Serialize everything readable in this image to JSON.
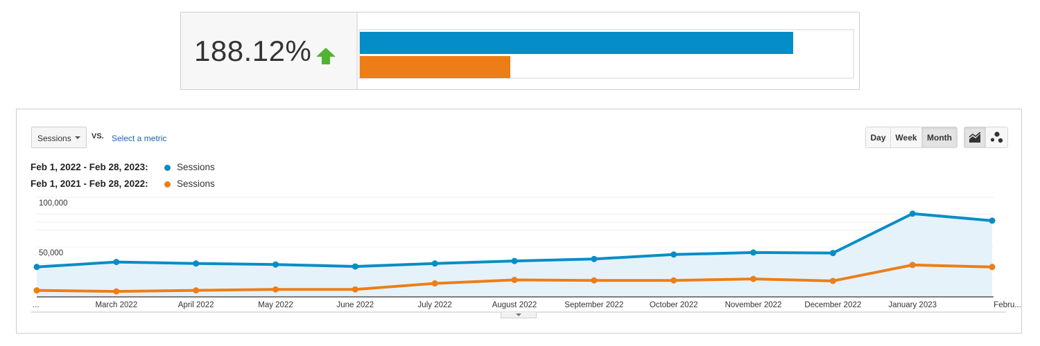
{
  "comparison": {
    "percent_change": "188.12%",
    "direction_icon": "up-arrow-icon",
    "current_bar_fraction": 0.879,
    "previous_bar_fraction": 0.305,
    "colors": {
      "current": "#058dc7",
      "previous": "#ed7e17",
      "up": "#50b432"
    }
  },
  "controls": {
    "metric_select": "Sessions",
    "vs_label": "VS.",
    "select_metric_link": "Select a metric",
    "period_buttons": [
      {
        "label": "Day",
        "active": false
      },
      {
        "label": "Week",
        "active": false
      },
      {
        "label": "Month",
        "active": true
      }
    ],
    "chart_type_buttons": [
      {
        "icon": "line-chart-icon",
        "active": true
      },
      {
        "icon": "motion-chart-icon",
        "active": false
      }
    ]
  },
  "legend": [
    {
      "range": "Feb 1, 2022 - Feb 28, 2023:",
      "series": "Sessions",
      "color": "#058dc7"
    },
    {
      "range": "Feb 1, 2021 - Feb 28, 2022:",
      "series": "Sessions",
      "color": "#ed7e17"
    }
  ],
  "chart_data": {
    "type": "line",
    "title": "",
    "xlabel": "",
    "ylabel": "Sessions",
    "ylim": [
      0,
      100000
    ],
    "y_ticks": [
      {
        "value": 100000,
        "label": "100,000"
      },
      {
        "value": 50000,
        "label": "50,000"
      }
    ],
    "grid": true,
    "categories": [
      "...",
      "March 2022",
      "April 2022",
      "May 2022",
      "June 2022",
      "July 2022",
      "August 2022",
      "September 2022",
      "October 2022",
      "November 2022",
      "December 2022",
      "January 2023",
      "Febru..."
    ],
    "series": [
      {
        "name": "Sessions (Feb 1, 2022 - Feb 28, 2023)",
        "color": "#058dc7",
        "area": true,
        "values": [
          30000,
          35000,
          33500,
          32500,
          30500,
          33500,
          36000,
          38000,
          42500,
          44500,
          44000,
          83500,
          76500
        ]
      },
      {
        "name": "Sessions (Feb 1, 2021 - Feb 28, 2022)",
        "color": "#ed7e17",
        "area": false,
        "values": [
          6500,
          5500,
          6500,
          7500,
          7500,
          13500,
          17000,
          16500,
          16500,
          18000,
          16000,
          32000,
          30000
        ]
      }
    ]
  }
}
